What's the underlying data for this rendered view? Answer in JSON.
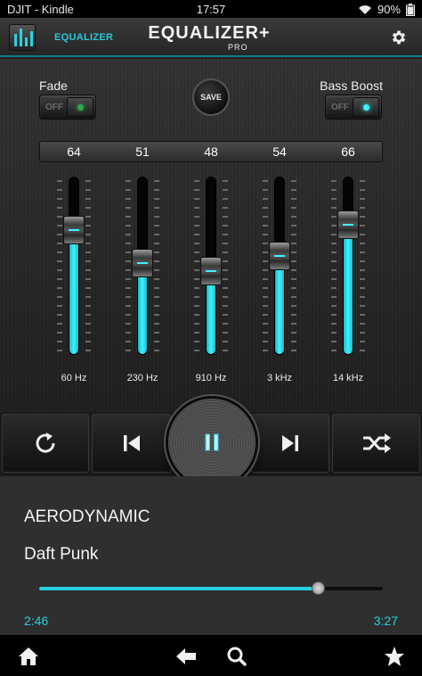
{
  "status_bar": {
    "carrier": "DJIT - Kindle",
    "time": "17:57",
    "battery": "90%"
  },
  "app_bar": {
    "nav_label": "EQUALIZER",
    "logo_main": "EQUALIZER+",
    "logo_sub": "PRO",
    "settings_icon": "gear-icon"
  },
  "controls": {
    "fade_label": "Fade",
    "fade_state": "OFF",
    "save_label": "SAVE",
    "bass_label": "Bass Boost",
    "bass_state": "OFF"
  },
  "bands": [
    {
      "value": "64",
      "freq": "60 Hz",
      "level": 64
    },
    {
      "value": "51",
      "freq": "230 Hz",
      "level": 51
    },
    {
      "value": "48",
      "freq": "910 Hz",
      "level": 48
    },
    {
      "value": "54",
      "freq": "3 kHz",
      "level": 54
    },
    {
      "value": "66",
      "freq": "14 kHz",
      "level": 66
    }
  ],
  "transport": [
    "repeat-icon",
    "previous-icon",
    "pause-icon",
    "next-icon",
    "shuffle-icon"
  ],
  "now_playing": {
    "title": "AERODYNAMIC",
    "artist": "Daft Punk",
    "elapsed": "2:46",
    "duration": "3:27",
    "progress": 0.81
  },
  "nav_bar": [
    "home-icon",
    "back-icon",
    "search-icon",
    "star-icon"
  ],
  "colors": {
    "accent": "#27cfe0",
    "fade_led": "#2aa84a",
    "bass_led": "#3ef2ff"
  }
}
